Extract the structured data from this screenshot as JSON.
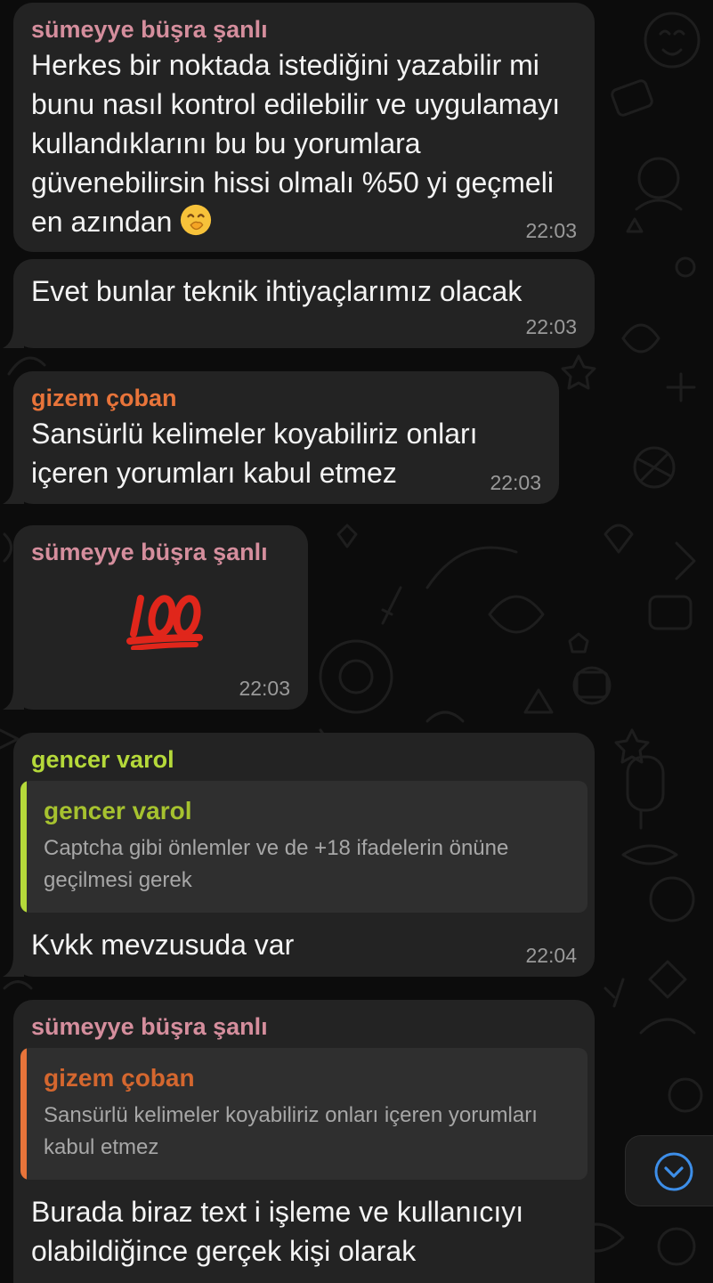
{
  "colors": {
    "sumeyye": "#d58e9d",
    "gizem": "#e8743a",
    "gencer": "#b5d93a",
    "bubble": "#232323",
    "timestamp": "#9a9a9a",
    "scroll_button_accent": "#3d8ee8"
  },
  "messages": [
    {
      "sender": "sümeyye büşra şanlı",
      "text": "Herkes bir noktada istediğini yazabilir mi bunu nasıl kontrol edilebilir ve uygulamayı kullandıklarını bu bu yorumlara güvenebilirsin hissi olmalı %50 yi geçmeli en azından",
      "emoji": "face-with-hand-over-mouth-icon",
      "time": "22:03"
    },
    {
      "text": "Evet bunlar teknik ihtiyaçlarımız olacak",
      "time": "22:03"
    },
    {
      "sender": "gizem çoban",
      "text": "Sansürlü kelimeler koyabiliriz onları içeren yorumları kabul etmez",
      "time": "22:03"
    },
    {
      "sender": "sümeyye büşra şanlı",
      "emoji": "hundred-points-icon",
      "time": "22:03"
    },
    {
      "sender": "gencer varol",
      "reply": {
        "sender": "gencer varol",
        "text": "Captcha gibi önlemler ve de +18 ifadelerin önüne geçilmesi gerek"
      },
      "text": "Kvkk mevzusuda var",
      "time": "22:04"
    },
    {
      "sender": "sümeyye büşra şanlı",
      "reply": {
        "sender": "gizem çoban",
        "text": "Sansürlü kelimeler koyabiliriz onları içeren yorumları kabul etmez"
      },
      "text": "Burada biraz text i işleme ve kullanıcıyı olabildiğince gerçek kişi olarak"
    }
  ],
  "scroll_button": {
    "icon": "chevron-down-icon"
  }
}
